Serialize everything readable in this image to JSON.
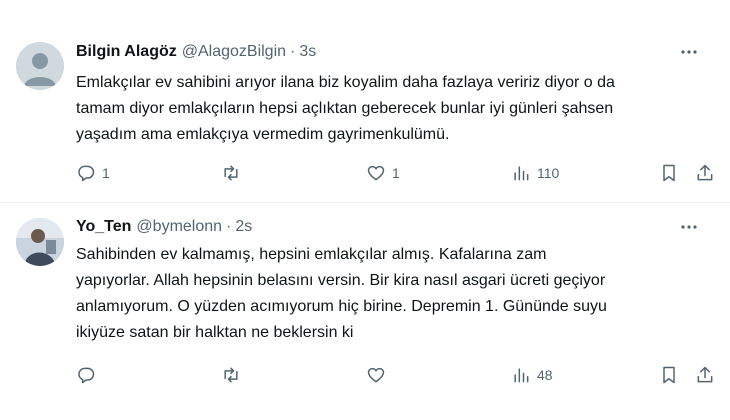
{
  "tweets": [
    {
      "name": "Bilgin Alagöz",
      "handle": "@AlagozBilgin",
      "separator": "·",
      "time": "3s",
      "text_lines": [
        "Emlakçılar ev sahibini arıyor ilana biz koyalim daha fazlaya veririz diyor o da",
        "tamam diyor emlakçıların hepsi açlıktan geberecek bunlar iyi günleri şahsen",
        "yaşadım ama emlakçıya vermedim gayrimenkulümü."
      ],
      "replies": "1",
      "retweets": "",
      "likes": "1",
      "views": "110"
    },
    {
      "name": "Yo_Ten",
      "handle": "@bymelonn",
      "separator": "·",
      "time": "2s",
      "text_lines": [
        "Sahibinden ev kalmamış, hepsini emlakçılar almış. Kafalarına zam",
        "yapıyorlar. Allah hepsinin belasını versin. Bir kira nasıl asgari ücreti geçiyor",
        "anlamıyorum. O yüzden acımıyorum hiç birine. Depremin 1. Gününde suyu",
        "ikiyüze satan bir halktan ne beklersin ki"
      ],
      "replies": "",
      "retweets": "",
      "likes": "",
      "views": "48"
    }
  ],
  "icons": {
    "reply": "reply-icon",
    "retweet": "retweet-icon",
    "like": "heart-icon",
    "views": "views-icon",
    "bookmark": "bookmark-icon",
    "share": "share-icon",
    "more": "more-icon"
  },
  "colors": {
    "text": "#0f1419",
    "secondary": "#536471",
    "divider": "#eff3f4"
  }
}
